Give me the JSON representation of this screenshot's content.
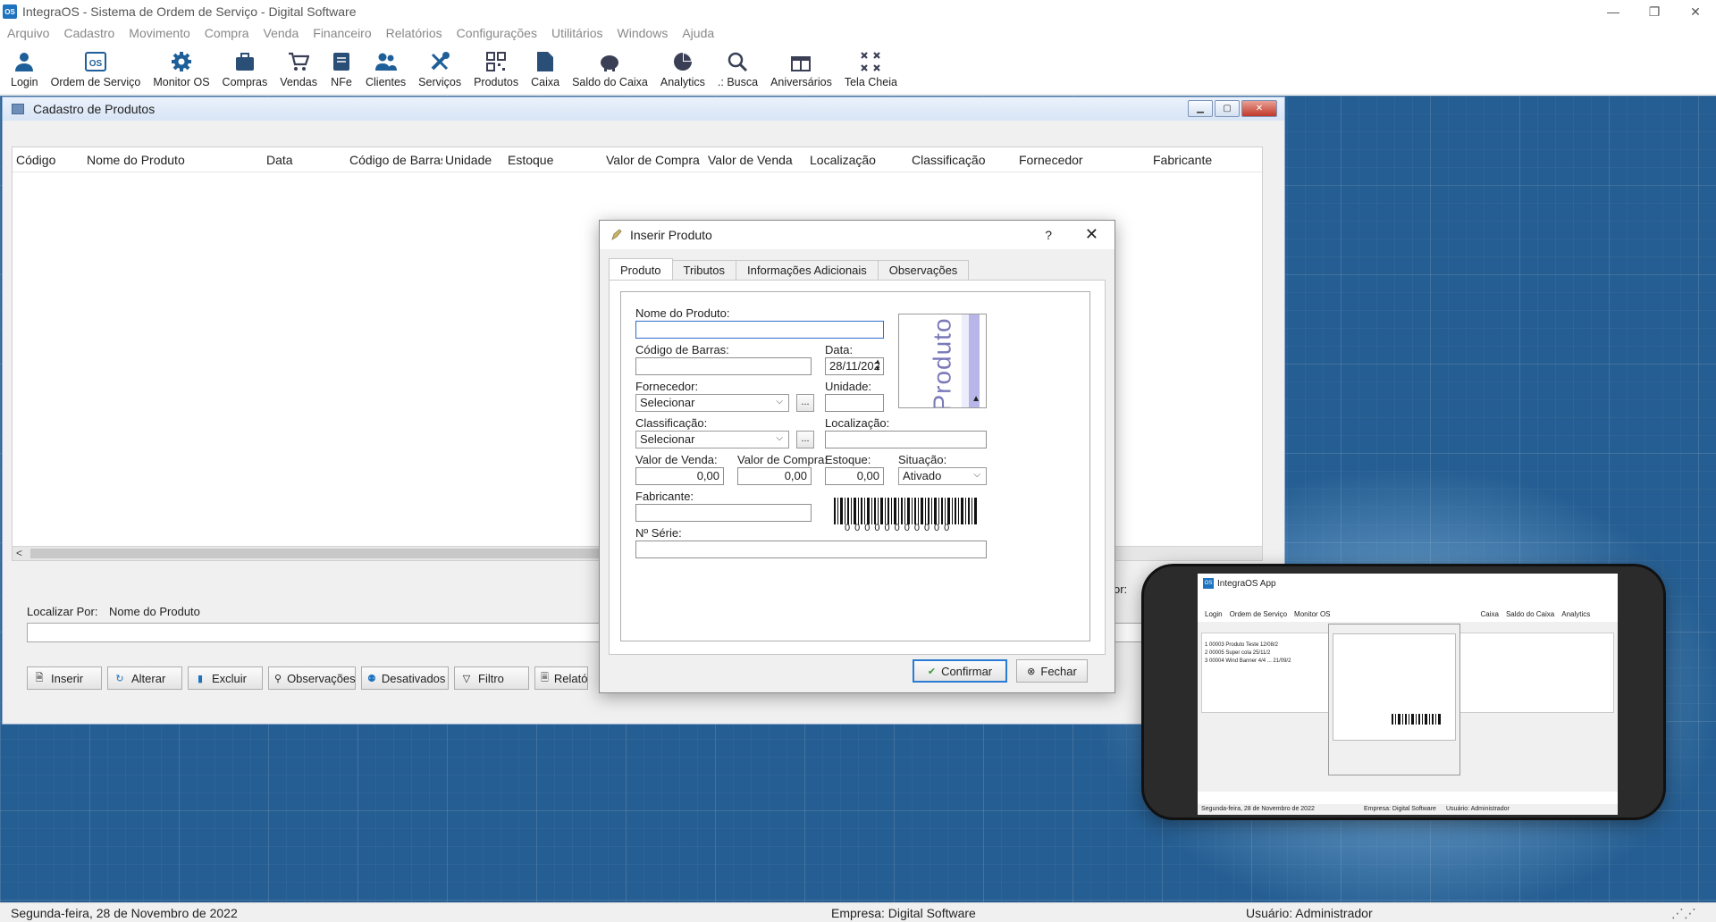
{
  "window": {
    "logo": "OS",
    "title": "IntegraOS - Sistema de Ordem de Serviço - Digital Software",
    "controls": [
      "—",
      "❐",
      "✕"
    ]
  },
  "menu": [
    "Arquivo",
    "Cadastro",
    "Movimento",
    "Compra",
    "Venda",
    "Financeiro",
    "Relatórios",
    "Configurações",
    "Utilitários",
    "Windows",
    "Ajuda"
  ],
  "toolbar": [
    {
      "label": "Login",
      "icon": "user-icon"
    },
    {
      "label": "Ordem de Serviço",
      "icon": "os-icon"
    },
    {
      "label": "Monitor OS",
      "icon": "gear-icon"
    },
    {
      "label": "Compras",
      "icon": "briefcase-icon"
    },
    {
      "label": "Vendas",
      "icon": "cart-icon"
    },
    {
      "label": "NFe",
      "icon": "invoice-icon"
    },
    {
      "label": "Clientes",
      "icon": "people-icon"
    },
    {
      "label": "Serviços",
      "icon": "tools-icon"
    },
    {
      "label": "Produtos",
      "icon": "qrcode-icon"
    },
    {
      "label": "Caixa",
      "icon": "document-icon"
    },
    {
      "label": "Saldo do Caixa",
      "icon": "piggy-bank-icon"
    },
    {
      "label": "Analytics",
      "icon": "pie-chart-icon"
    },
    {
      "label": ".: Busca",
      "icon": "search-icon"
    },
    {
      "label": "Aniversários",
      "icon": "gift-icon"
    },
    {
      "label": "Tela Cheia",
      "icon": "fullscreen-icon"
    }
  ],
  "cadastro": {
    "title": "Cadastro de Produtos",
    "columns": [
      "Código",
      "Nome do Produto",
      "Data",
      "Código de Barras",
      "Unidade",
      "Estoque",
      "Valor de Compra",
      "Valor de Venda",
      "Localização",
      "Classificação",
      "Fornecedor",
      "Fabricante"
    ],
    "localizar_label": "Localizar Por:",
    "localizar_value": "Nome do Produto",
    "ordenar_label": "or:",
    "buttons": [
      "Inserir",
      "Alterar",
      "Excluir",
      "Observações",
      "Desativados",
      "Filtro",
      "Relatór"
    ]
  },
  "dialog": {
    "title": "Inserir Produto",
    "help": "?",
    "close": "✕",
    "tabs": [
      "Produto",
      "Tributos",
      "Informações Adicionais",
      "Observações"
    ],
    "active_tab": "Produto",
    "fields": {
      "nome_label": "Nome do Produto:",
      "nome_value": "",
      "codigo_barras_label": "Código de Barras:",
      "data_label": "Data:",
      "data_value": "28/11/202",
      "fornecedor_label": "Fornecedor:",
      "fornecedor_value": "Selecionar",
      "unidade_label": "Unidade:",
      "classificacao_label": "Classificação:",
      "classificacao_value": "Selecionar",
      "localizacao_label": "Localização:",
      "valor_venda_label": "Valor de Venda:",
      "valor_venda_value": "0,00",
      "valor_compra_label": "Valor de Compra:",
      "valor_compra_value": "0,00",
      "estoque_label": "Estoque:",
      "estoque_value": "0,00",
      "situacao_label": "Situação:",
      "situacao_value": "Ativado",
      "fabricante_label": "Fabricante:",
      "serie_label": "Nº Série:",
      "dots": "...",
      "image_word": "Produto",
      "barcode_digits": "00000000000"
    },
    "confirm_label": "Confirmar",
    "close_label": "Fechar"
  },
  "phone": {
    "title": "IntegraOS App",
    "toolbar": [
      "Login",
      "Ordem de Serviço",
      "Monitor OS",
      "Caixa",
      "Saldo do Caixa",
      "Analytics"
    ],
    "rows": [
      {
        "code": "1 00003",
        "name": "Produto Teste",
        "date": "12/08/2"
      },
      {
        "code": "2 00005",
        "name": "Super cola",
        "date": "25/11/2"
      },
      {
        "code": "3 00004",
        "name": "Wind Banner 4/4 ...",
        "date": "21/09/2"
      }
    ],
    "status_date": "Segunda-feira, 28 de Novembro de 2022",
    "status_company": "Empresa: Digital Software",
    "status_user": "Usuário: Administrador"
  },
  "status": {
    "date": "Segunda-feira, 28 de Novembro de 2022",
    "company": "Empresa: Digital Software",
    "user": "Usuário: Administrador"
  },
  "colors": {
    "accent": "#1e73be",
    "desktop": "#255e92",
    "focus": "#2f6ecb"
  }
}
